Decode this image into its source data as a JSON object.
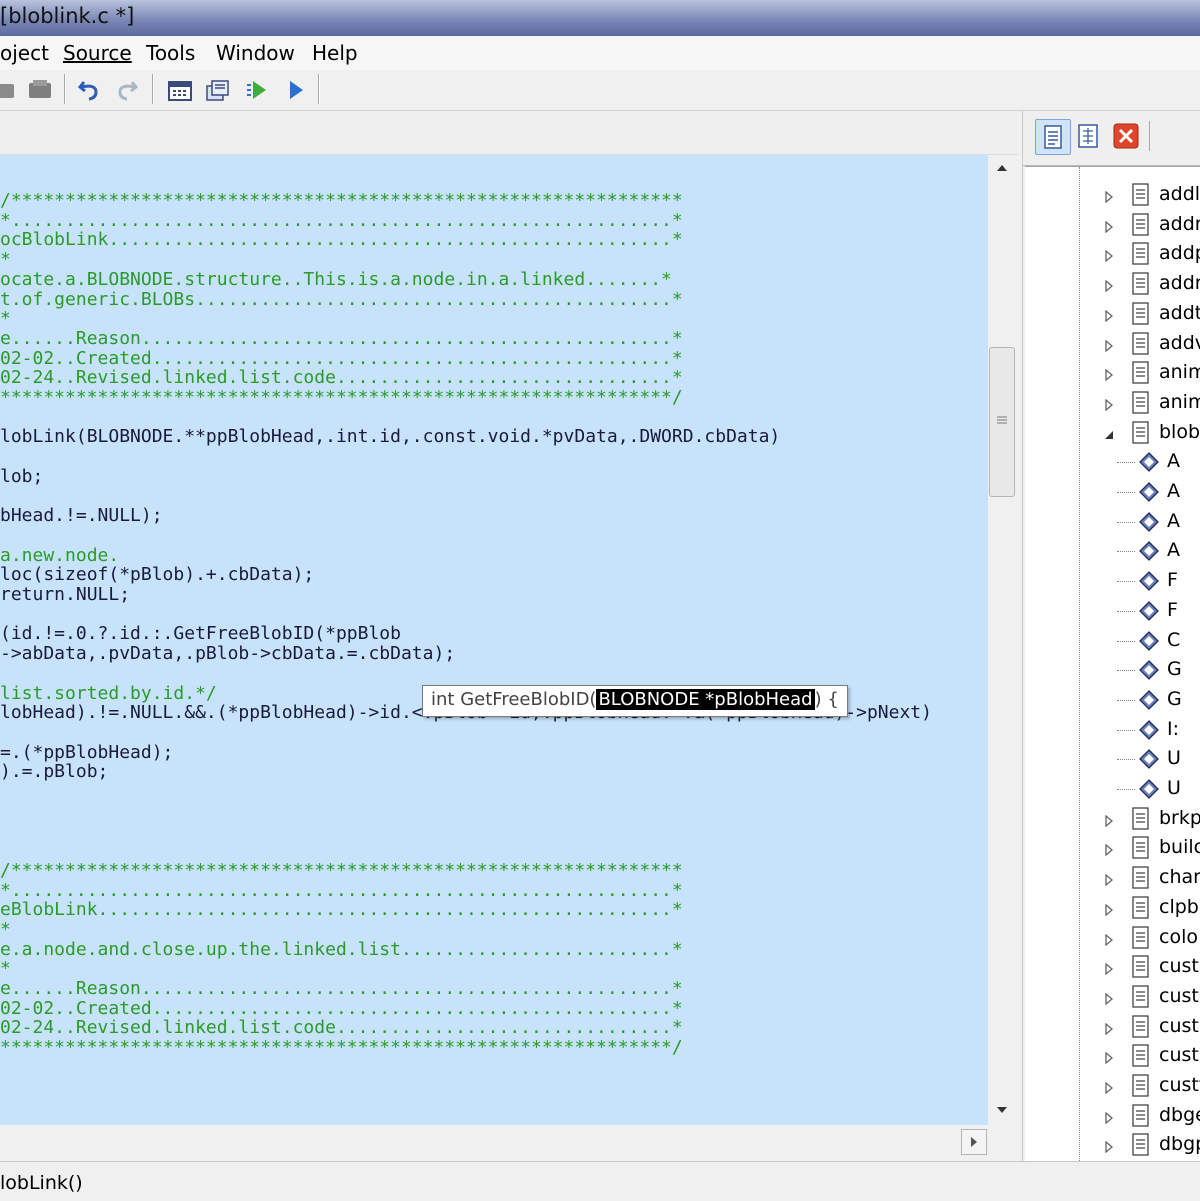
{
  "window": {
    "title": "[bloblink.c *]"
  },
  "menu": [
    "oject",
    "Source",
    "Tools",
    "Window",
    "Help"
  ],
  "toolbar": {
    "icons": [
      "cut-icon",
      "paste-icon",
      "undo-icon",
      "redo-icon",
      "calendar-icon",
      "save-all-icon",
      "run-icon",
      "debug-run-icon"
    ]
  },
  "editor": {
    "lines": [
      {
        "t": "/**************************************************************",
        "c": "green"
      },
      {
        "t": "*.............................................................*",
        "c": "green"
      },
      {
        "t": "ocBlobLink....................................................*",
        "c": "green"
      },
      {
        "t": "*",
        "c": "green"
      },
      {
        "t": "ocate.a.BLOBNODE.structure..This.is.a.node.in.a.linked.......*",
        "c": "green"
      },
      {
        "t": "t.of.generic.BLOBs............................................*",
        "c": "green"
      },
      {
        "t": "*",
        "c": "green"
      },
      {
        "t": "e......Reason.................................................*",
        "c": "green"
      },
      {
        "t": "02-02..Created................................................*",
        "c": "green"
      },
      {
        "t": "02-24..Revised.linked.list.code...............................*",
        "c": "green"
      },
      {
        "t": "**************************************************************/",
        "c": "green"
      },
      {
        "t": "",
        "c": "blk"
      },
      {
        "t": "lobLink(BLOBNODE.**ppBlobHead,.int.id,.const.void.*pvData,.DWORD.cbData)",
        "c": "blk"
      },
      {
        "t": "",
        "c": "blk"
      },
      {
        "t": "lob;",
        "c": "blk"
      },
      {
        "t": "",
        "c": "blk"
      },
      {
        "t": "bHead.!=.NULL);",
        "c": "blk"
      },
      {
        "t": "",
        "c": "blk"
      },
      {
        "t": "a.new.node.",
        "c": "green"
      },
      {
        "t": "loc(sizeof(*pBlob).+.cbData);",
        "c": "blk"
      },
      {
        "t": "return.NULL;",
        "c": "blk"
      },
      {
        "t": "",
        "c": "blk"
      },
      {
        "t": "(id.!=.0.?.id.:.GetFreeBlobID(*ppBlob",
        "c": "blk"
      },
      {
        "t": "->abData,.pvData,.pBlob->cbData.=.cbData);",
        "c": "blk"
      },
      {
        "t": "",
        "c": "blk"
      },
      {
        "t": "list.sorted.by.id.*/",
        "c": "green"
      },
      {
        "t": "lobHead).!=.NULL.&&.(*ppBlobHead)->id.<.pBlob->id;.ppBlobHead.=.&(*ppBlobHead)->pNext)",
        "c": "blk"
      },
      {
        "t": "",
        "c": "blk"
      },
      {
        "t": "=.(*ppBlobHead);",
        "c": "blk"
      },
      {
        "t": ").=.pBlob;",
        "c": "blk"
      },
      {
        "t": "",
        "c": "blk"
      },
      {
        "t": "",
        "c": "blk"
      },
      {
        "t": "",
        "c": "blk"
      },
      {
        "t": "",
        "c": "blk"
      },
      {
        "t": "/**************************************************************",
        "c": "green"
      },
      {
        "t": "*.............................................................*",
        "c": "green"
      },
      {
        "t": "eBlobLink.....................................................*",
        "c": "green"
      },
      {
        "t": "*",
        "c": "green"
      },
      {
        "t": "e.a.node.and.close.up.the.linked.list.........................*",
        "c": "green"
      },
      {
        "t": "*",
        "c": "green"
      },
      {
        "t": "e......Reason.................................................*",
        "c": "green"
      },
      {
        "t": "02-02..Created................................................*",
        "c": "green"
      },
      {
        "t": "02-24..Revised.linked.list.code...............................*",
        "c": "green"
      },
      {
        "t": "**************************************************************/",
        "c": "green"
      }
    ],
    "tooltip": {
      "prefix": "int GetFreeBlobID(",
      "param": "BLOBNODE *pBlobHead",
      "suffix": ") {"
    }
  },
  "tree": {
    "items": [
      {
        "label": "addl",
        "type": "file"
      },
      {
        "label": "addr",
        "type": "file"
      },
      {
        "label": "addp",
        "type": "file"
      },
      {
        "label": "addr",
        "type": "file"
      },
      {
        "label": "addt",
        "type": "file"
      },
      {
        "label": "addv",
        "type": "file"
      },
      {
        "label": "anim",
        "type": "file"
      },
      {
        "label": "anim",
        "type": "file"
      },
      {
        "label": "blob",
        "type": "file-open"
      },
      {
        "label": "A",
        "type": "func"
      },
      {
        "label": "A",
        "type": "func"
      },
      {
        "label": "A",
        "type": "func"
      },
      {
        "label": "A",
        "type": "func"
      },
      {
        "label": "F",
        "type": "func"
      },
      {
        "label": "F",
        "type": "func"
      },
      {
        "label": "C",
        "type": "func"
      },
      {
        "label": "G",
        "type": "func"
      },
      {
        "label": "G",
        "type": "func"
      },
      {
        "label": "I:",
        "type": "func"
      },
      {
        "label": "U",
        "type": "func"
      },
      {
        "label": "U",
        "type": "func"
      },
      {
        "label": "brkp",
        "type": "file"
      },
      {
        "label": "builc",
        "type": "file"
      },
      {
        "label": "char",
        "type": "file"
      },
      {
        "label": "clpb",
        "type": "file"
      },
      {
        "label": "colo",
        "type": "file"
      },
      {
        "label": "custe",
        "type": "file"
      },
      {
        "label": "custe",
        "type": "file"
      },
      {
        "label": "custl",
        "type": "file"
      },
      {
        "label": "custl",
        "type": "file"
      },
      {
        "label": "custt",
        "type": "file"
      },
      {
        "label": "dbge",
        "type": "file"
      },
      {
        "label": "dbgp",
        "type": "file"
      }
    ]
  },
  "status": {
    "text": "lobLink()"
  }
}
